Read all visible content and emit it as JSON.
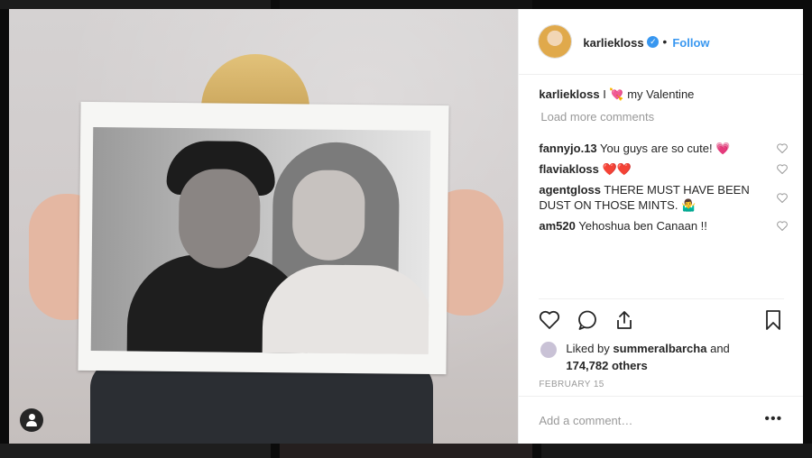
{
  "post": {
    "username": "karliekloss",
    "follow_label": "Follow",
    "dot": "•",
    "verified_glyph": "✓"
  },
  "caption": {
    "username": "karliekloss",
    "text": "I 💘 my Valentine"
  },
  "load_more": "Load more comments",
  "comments": [
    {
      "username": "fannyjo.13",
      "text": "You guys are so cute! 💗"
    },
    {
      "username": "flaviakloss",
      "text": "❤️❤️"
    },
    {
      "username": "agentgloss",
      "text": "THERE MUST HAVE BEEN DUST ON THOSE MINTS. 🤷‍♂️"
    },
    {
      "username": "am520",
      "text": "Yehoshua ben Canaan !!"
    }
  ],
  "likes": {
    "prefix": "Liked by",
    "user": "summeralbarcha",
    "and": "and",
    "count": "174,782 others"
  },
  "date": "FEBRUARY 15",
  "add_comment_placeholder": "Add a comment…",
  "more_glyph": "•••",
  "icons": {
    "like": "heart-icon",
    "comment": "comment-icon",
    "share": "share-icon",
    "save": "bookmark-icon"
  },
  "colors": {
    "accent": "#3897f0",
    "text": "#262626",
    "muted": "#999999"
  }
}
